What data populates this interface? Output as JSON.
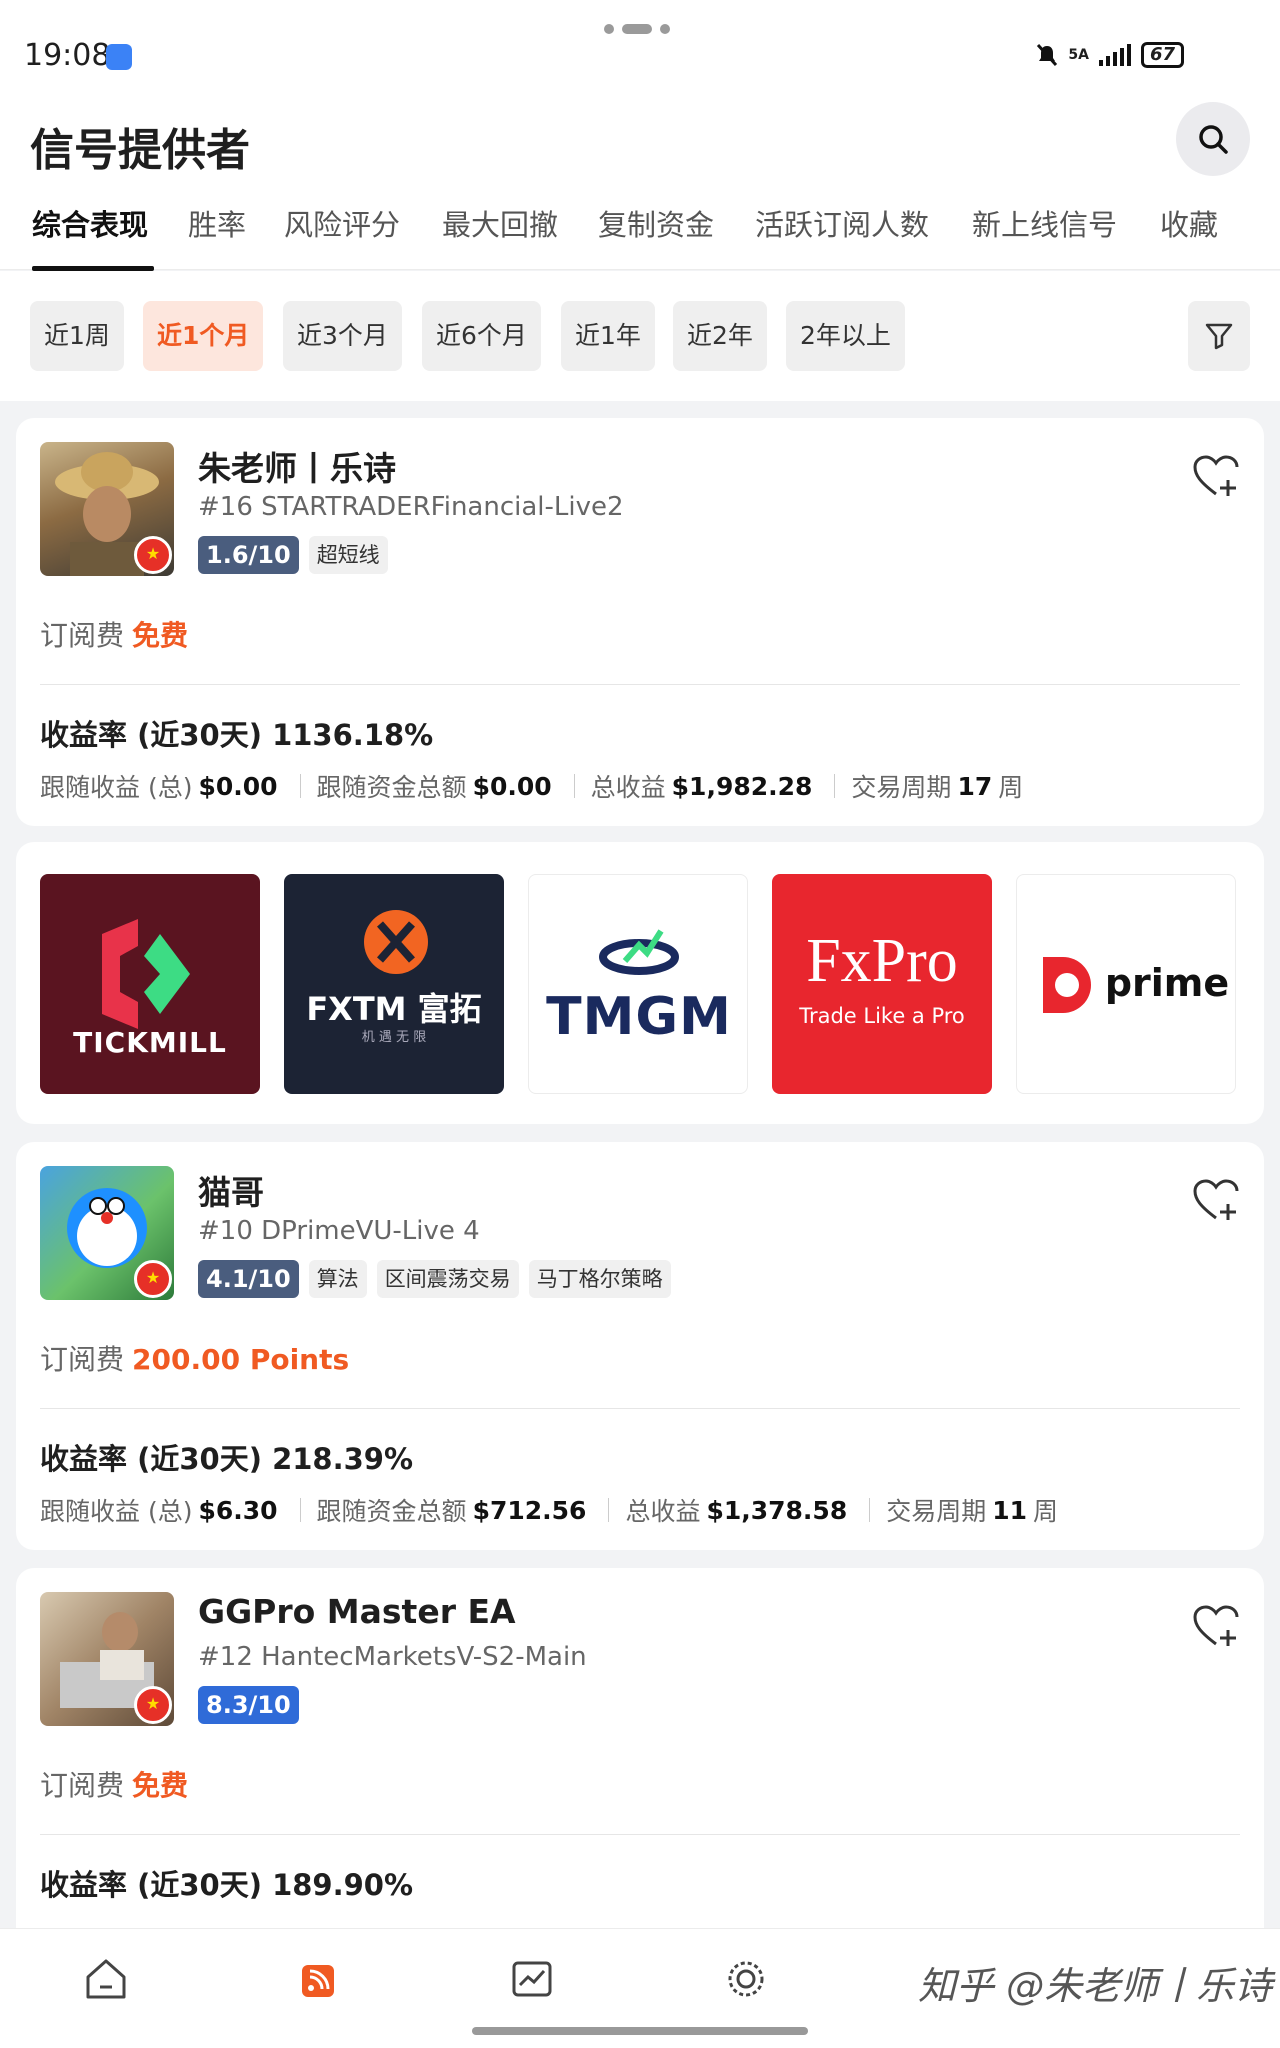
{
  "status": {
    "time": "19:08",
    "network": "5A",
    "battery": "67"
  },
  "header": {
    "title": "信号提供者"
  },
  "tabs": [
    {
      "label": "综合表现",
      "active": true
    },
    {
      "label": "胜率",
      "active": false
    },
    {
      "label": "风险评分",
      "active": false
    },
    {
      "label": "最大回撤",
      "active": false
    },
    {
      "label": "复制资金",
      "active": false
    },
    {
      "label": "活跃订阅人数",
      "active": false
    },
    {
      "label": "新上线信号",
      "active": false
    },
    {
      "label": "收藏",
      "active": false
    }
  ],
  "periods": [
    {
      "label": "近1周",
      "active": false
    },
    {
      "label": "近1个月",
      "active": true
    },
    {
      "label": "近3个月",
      "active": false
    },
    {
      "label": "近6个月",
      "active": false
    },
    {
      "label": "近1年",
      "active": false
    },
    {
      "label": "近2年",
      "active": false
    },
    {
      "label": "2年以上",
      "active": false
    }
  ],
  "labels": {
    "fee": "订阅费",
    "return": "收益率 (近30天)",
    "follow_profit": "跟随收益 (总)",
    "follow_funds": "跟随资金总额",
    "total_profit": "总收益",
    "trade_period": "交易周期",
    "week_unit": "周"
  },
  "signals": [
    {
      "name": "朱老师丨乐诗",
      "account": "#16 STARTRADERFinancial-Live2",
      "score": "1.6/10",
      "score_color": "#4a5d7e",
      "tags": [
        "超短线"
      ],
      "fee": "免费",
      "return": "1136.18%",
      "follow_profit": "$0.00",
      "follow_funds": "$0.00",
      "total_profit": "$1,982.28",
      "weeks": "17",
      "flag": "★"
    },
    {
      "name": "猫哥",
      "account": "#10 DPrimeVU-Live 4",
      "score": "4.1/10",
      "score_color": "#4a5d7e",
      "tags": [
        "算法",
        "区间震荡交易",
        "马丁格尔策略"
      ],
      "fee": "200.00 Points",
      "return": "218.39%",
      "follow_profit": "$6.30",
      "follow_funds": "$712.56",
      "total_profit": "$1,378.58",
      "weeks": "11",
      "flag": "★"
    },
    {
      "name": "GGPro Master EA",
      "account": "#12 HantecMarketsV-S2-Main",
      "score": "8.3/10",
      "score_color": "#2f6bd8",
      "tags": [],
      "fee": "免费",
      "return": "189.90%",
      "flag": "★"
    }
  ],
  "brands": [
    {
      "name": "TICKMILL",
      "bg": "#5a1420"
    },
    {
      "name": "FXTM 富拓",
      "sub": "机 遇 无 限",
      "bg": "#1c2334"
    },
    {
      "name": "TMGM",
      "bg": "#ffffff"
    },
    {
      "name": "FxPro",
      "sub": "Trade Like a Pro",
      "bg": "#e8262e"
    },
    {
      "name": "prime",
      "bg": "#ffffff"
    }
  ],
  "watermark": "知乎 @朱老师丨乐诗"
}
